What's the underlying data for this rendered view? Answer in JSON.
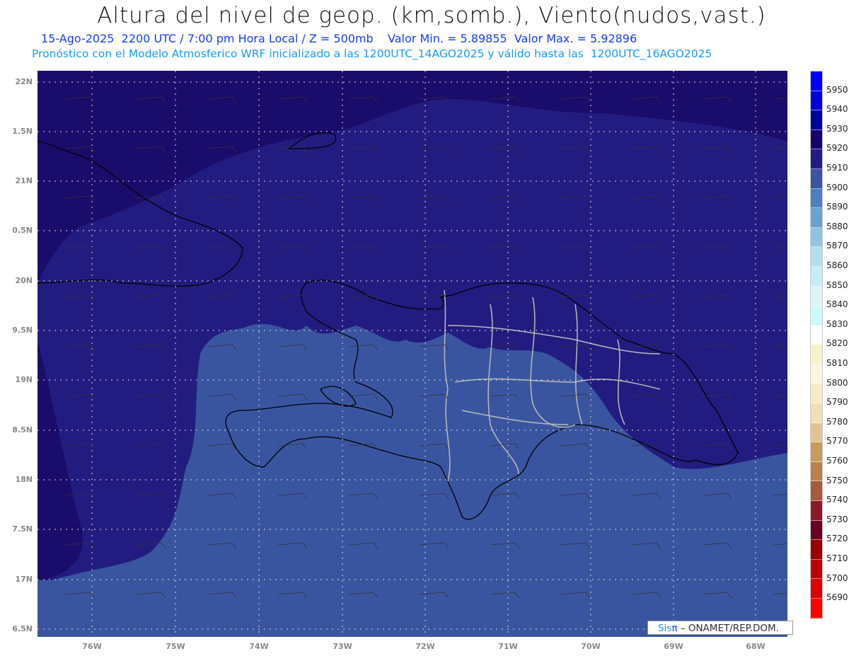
{
  "title": "Altura del nivel de geop. (km,somb.), Viento(nudos,vast.)",
  "subtitle_date": "15-Ago-2025  2200 UTC / 7:00 pm Hora Local / Z = 500mb    Valor Min. = 5.89855  Valor Max. = 5.92896",
  "subtitle_model": "Pronóstico con el Modelo Atmosferico WRF inicializado a las 1200UTC_14AGO2025 y válido hasta las  1200UTC_16AGO2025",
  "lat_labels": [
    "22N",
    "1.5N",
    "21N",
    "0.5N",
    "20N",
    "9.5N",
    "19N",
    "8.5N",
    "18N",
    "7.5N",
    "17N",
    "6.5N"
  ],
  "lon_labels": [
    "76W",
    "75W",
    "74W",
    "73W",
    "72W",
    "71W",
    "70W",
    "69W",
    "68W"
  ],
  "colorbar": {
    "labels": [
      "5950",
      "5940",
      "5930",
      "5920",
      "5910",
      "5900",
      "5890",
      "5880",
      "5870",
      "5860",
      "5850",
      "5840",
      "5830",
      "5820",
      "5810",
      "5800",
      "5790",
      "5780",
      "5770",
      "5760",
      "5750",
      "5740",
      "5730",
      "5720",
      "5710",
      "5700",
      "5690"
    ],
    "colors": [
      "#0000ff",
      "#0000dc",
      "#00009c",
      "#150070",
      "#221c80",
      "#3a55a0",
      "#4a80c0",
      "#68a2d0",
      "#8fc3e2",
      "#b0dfee",
      "#c4ecf4",
      "#def4f8",
      "#ccfafb",
      "#ffffff",
      "#f8f2c8",
      "#faf5de",
      "#f6ecc4",
      "#efdfb3",
      "#dfc48f",
      "#c89a62",
      "#bb8050",
      "#a55a3a",
      "#8a1a2a",
      "#6a0020",
      "#9a0000",
      "#c00000",
      "#dc0000",
      "#ff0000"
    ]
  },
  "field_colors": {
    "high": "#1a0c6b",
    "mid": "#231c80",
    "low": "#3a55a0"
  },
  "logo": {
    "sis": "Sis",
    "pi": "π",
    "org": " – ONAMET/REP.DOM."
  }
}
